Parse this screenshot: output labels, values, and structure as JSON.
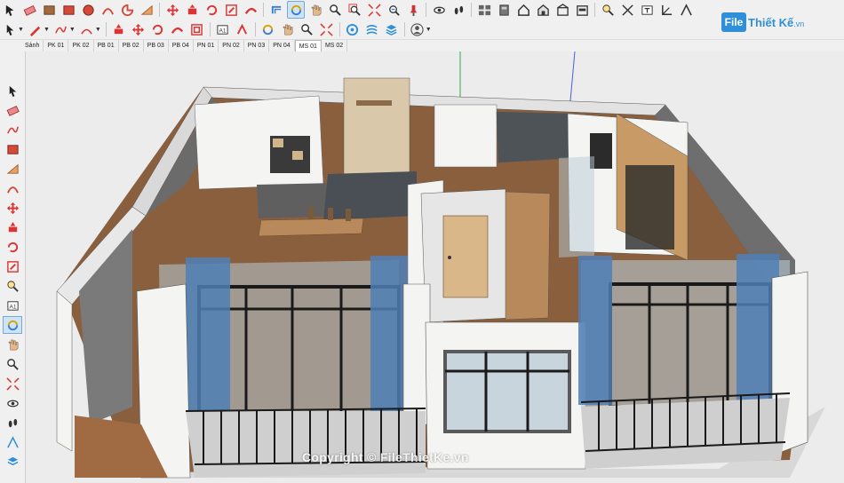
{
  "branding": {
    "logo_box": "File",
    "logo_name": "Thiết Kế",
    "logo_tld": ".vn"
  },
  "watermark": "Copyright © FileThietKe.vn",
  "scenes": {
    "tabs": [
      "Sảnh",
      "PK 01",
      "PK 02",
      "PB 01",
      "PB 02",
      "PB 03",
      "PB 04",
      "PN 01",
      "PN 02",
      "PN 03",
      "PN 04",
      "MS 01",
      "MS 02"
    ],
    "active": "MS 01"
  },
  "colors": {
    "accent": "#2f8fd8",
    "toolbar_bg": "#f0f0f0",
    "wall_white": "#f4f4f2",
    "wood_floor": "#8a5f3e",
    "curtain_blue": "#4f7fb6",
    "glass": "#b7c9d3"
  },
  "toolbar_row1_icons": [
    "select-icon",
    "eraser-icon",
    "paint-bucket-icon",
    "rectangle-icon",
    "circle-icon",
    "arc-icon",
    "pie-icon",
    "polygon-icon",
    "move-icon",
    "push-pull-icon",
    "rotate-icon",
    "scale-icon",
    "follow-me-icon",
    "offset-icon",
    "orbit-icon",
    "pan-icon",
    "zoom-icon",
    "zoom-window-icon",
    "zoom-extents-icon",
    "previous-view-icon",
    "position-camera-icon",
    "walk-icon",
    "look-around-icon",
    "components-icon",
    "materials-icon",
    "home-view-icon",
    "front-view-icon",
    "back-view-icon",
    "right-view-icon",
    "tape-measure-icon",
    "dimension-icon",
    "text-icon",
    "axes-icon",
    "section-plane-icon"
  ],
  "toolbar_row2_icons": [
    "select-arrow-icon",
    "pencil-line-icon",
    "freehand-icon",
    "arc-2pt-icon",
    "pushpull-icon",
    "move-arrows-icon",
    "rotate-2-icon",
    "follow-icon",
    "offset-2-icon",
    "text-label-icon",
    "3d-text-icon",
    "orbit-2-icon",
    "pan-2-icon",
    "zoom-2-icon",
    "zoom-ext-2-icon",
    "warehouse-icon",
    "extension-icon",
    "layers-icon",
    "user-account-icon"
  ]
}
